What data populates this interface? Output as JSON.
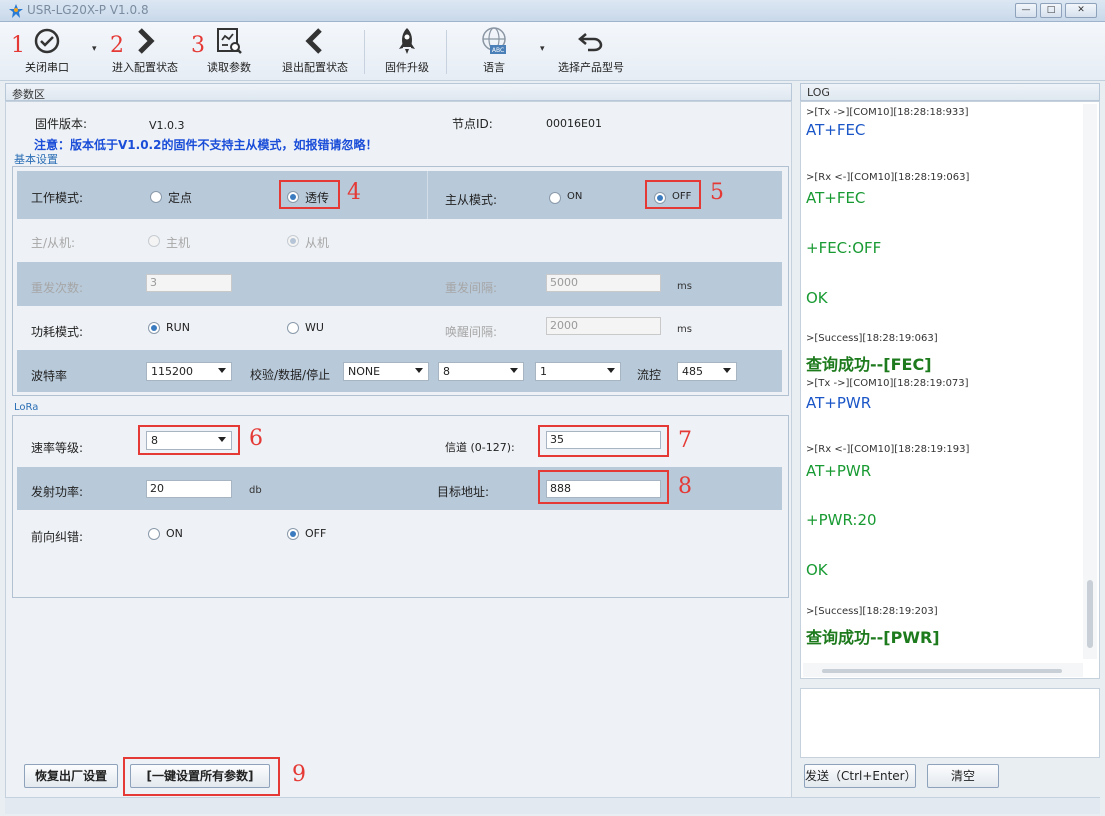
{
  "window": {
    "title": "USR-LG20X-P  V1.0.8",
    "min": "—",
    "max": "□",
    "close": "✕"
  },
  "toolbar": {
    "items": [
      {
        "label": "关闭串口",
        "icon": "check-circle-icon"
      },
      {
        "label": "进入配置状态",
        "icon": "chevron-right-icon"
      },
      {
        "label": "读取参数",
        "icon": "read-params-icon"
      },
      {
        "label": "退出配置状态",
        "icon": "chevron-left-icon"
      },
      {
        "label": "固件升级",
        "icon": "rocket-icon"
      },
      {
        "label": "语言",
        "icon": "globe-abc-icon"
      },
      {
        "label": "选择产品型号",
        "icon": "undo-arrow-icon"
      }
    ]
  },
  "annotations": [
    "1",
    "2",
    "3",
    "4",
    "5",
    "6",
    "7",
    "8",
    "9"
  ],
  "params": {
    "panel_title": "参数区",
    "firmware_label": "固件版本:",
    "firmware_value": "V1.0.3",
    "node_id_label": "节点ID:",
    "node_id_value": "00016E01",
    "notice": "注意：版本低于V1.0.2的固件不支持主从模式，如报错请忽略！"
  },
  "basic": {
    "section_title": "基本设置",
    "work_mode_label": "工作模式:",
    "work_mode_options": [
      "定点",
      "透传"
    ],
    "master_slave_mode_label": "主从模式:",
    "master_slave_mode_options": [
      "ON",
      "OFF"
    ],
    "role_label": "主/从机:",
    "role_options": [
      "主机",
      "从机"
    ],
    "retry_count_label": "重发次数:",
    "retry_count_value": "3",
    "retry_interval_label": "重发间隔:",
    "retry_interval_value": "5000",
    "ms": "ms",
    "power_mode_label": "功耗模式:",
    "power_mode_options": [
      "RUN",
      "WU"
    ],
    "wake_interval_label": "唤醒间隔:",
    "wake_interval_value": "2000",
    "baud_label": "波特率",
    "baud_value": "115200",
    "parity_label": "校验/数据/停止",
    "parity_value": "NONE",
    "data_bits_value": "8",
    "stop_bits_value": "1",
    "flow_label": "流控",
    "flow_value": "485"
  },
  "lora": {
    "section_title": "LoRa",
    "speed_label": "速率等级:",
    "speed_value": "8",
    "channel_label": "信道 (0-127):",
    "channel_value": "35",
    "tx_power_label": "发射功率:",
    "tx_power_value": "20",
    "db": "db",
    "target_addr_label": "目标地址:",
    "target_addr_value": "888",
    "fec_label": "前向纠错:",
    "fec_options": [
      "ON",
      "OFF"
    ]
  },
  "buttons": {
    "restore": "恢复出厂设置",
    "set_all": "[一键设置所有参数]",
    "send": "发送（Ctrl+Enter）",
    "clear": "清空"
  },
  "log": {
    "title": "LOG",
    "entries": [
      ">[Tx ->][COM10][18:28:18:933]",
      "AT+FEC",
      ">[Rx <-][COM10][18:28:19:063]",
      "AT+FEC",
      "+FEC:OFF",
      "OK",
      ">[Success][18:28:19:063]",
      "查询成功--[FEC]",
      ">[Tx ->][COM10][18:28:19:073]",
      "AT+PWR",
      ">[Rx <-][COM10][18:28:19:193]",
      "AT+PWR",
      "+PWR:20",
      "OK",
      ">[Success][18:28:19:203]",
      "查询成功--[PWR]"
    ]
  }
}
